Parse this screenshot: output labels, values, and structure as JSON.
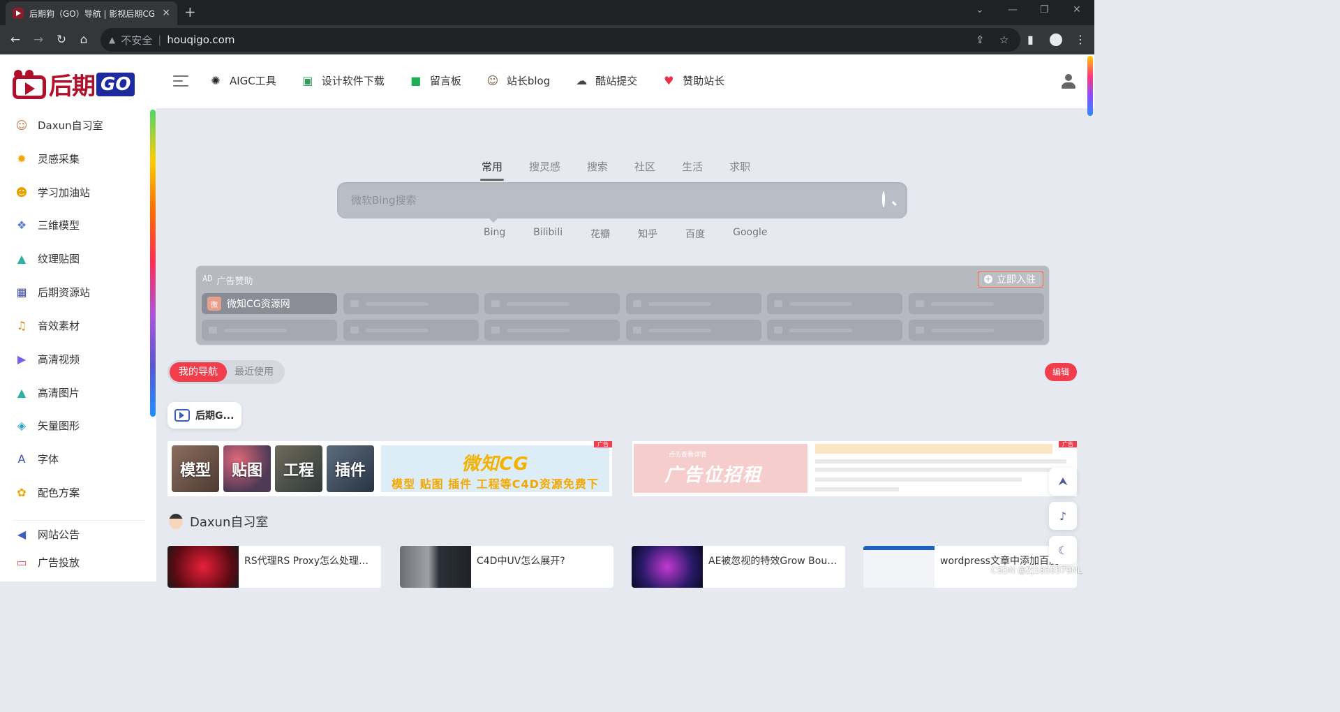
{
  "browser": {
    "tab_title": "后期狗（GO）导航 | 影视后期CG",
    "tab_close": "✕",
    "new_tab": "+",
    "back": "←",
    "forward": "→",
    "reload": "↻",
    "home": "⌂",
    "security_icon": "▲",
    "insecure_label": "不安全",
    "separator": "|",
    "url": "houqigo.com",
    "share": "⇪",
    "bookmark": "☆",
    "sidepanel": "▮",
    "menu": "⋮",
    "win_chevron": "⌄",
    "win_min": "—",
    "win_max": "❐",
    "win_close": "✕"
  },
  "header": {
    "logo_text": "后期",
    "logo_go": "GO",
    "nav": [
      {
        "label": "AIGC工具",
        "icon": "sparkle-dragon-icon",
        "glyph": "✺",
        "color": "#222"
      },
      {
        "label": "设计软件下载",
        "icon": "floppy-save-icon",
        "glyph": "▣",
        "color": "#2e9e5b"
      },
      {
        "label": "留言板",
        "icon": "message-board-icon",
        "glyph": "■",
        "color": "#1fae55"
      },
      {
        "label": "站长blog",
        "icon": "avatar-face-icon",
        "glyph": "☺",
        "color": "#7a5a3c"
      },
      {
        "label": "酷站提交",
        "icon": "cloud-upload-icon",
        "glyph": "☁",
        "color": "#444"
      },
      {
        "label": "赞助站长",
        "icon": "heart-icon",
        "glyph": "♥",
        "color": "#e8304b"
      }
    ]
  },
  "sidebar": {
    "items": [
      {
        "label": "Daxun自习室",
        "icon": "avatar-face-icon",
        "glyph": "☺",
        "color": "#c07a4a"
      },
      {
        "label": "灵感采集",
        "icon": "lightbulb-icon",
        "glyph": "✹",
        "color": "#f0a400"
      },
      {
        "label": "学习加油站",
        "icon": "head-idea-icon",
        "glyph": "☻",
        "color": "#e8a200"
      },
      {
        "label": "三维模型",
        "icon": "cubes-icon",
        "glyph": "❖",
        "color": "#5a7ad0"
      },
      {
        "label": "纹理贴图",
        "icon": "landscape-icon",
        "glyph": "▲",
        "color": "#2bb3a0"
      },
      {
        "label": "后期资源站",
        "icon": "clapperboard-icon",
        "glyph": "▦",
        "color": "#3d4fa8"
      },
      {
        "label": "音效素材",
        "icon": "music-note-icon",
        "glyph": "♫",
        "color": "#d08a1a"
      },
      {
        "label": "高清视频",
        "icon": "video-camera-icon",
        "glyph": "▶",
        "color": "#7b5cf0"
      },
      {
        "label": "高清图片",
        "icon": "image-icon",
        "glyph": "▲",
        "color": "#2bb3a0"
      },
      {
        "label": "矢量图形",
        "icon": "vector-gem-icon",
        "glyph": "◈",
        "color": "#2ba6c8"
      },
      {
        "label": "字体",
        "icon": "font-letter-icon",
        "glyph": "A",
        "color": "#3d4fa8"
      },
      {
        "label": "配色方案",
        "icon": "palette-icon",
        "glyph": "✿",
        "color": "#f0a400"
      },
      {
        "label": "网站公告",
        "icon": "megaphone-icon",
        "glyph": "◀",
        "color": "#3d5fc0"
      },
      {
        "label": "广告投放",
        "icon": "billboard-icon",
        "glyph": "▭",
        "color": "#e84a5f"
      }
    ]
  },
  "search": {
    "tabs": [
      "常用",
      "搜灵感",
      "搜索",
      "社区",
      "生活",
      "求职"
    ],
    "active_tab": 0,
    "placeholder": "微软Bing搜索",
    "engines": [
      "Bing",
      "Bilibili",
      "花瓣",
      "知乎",
      "百度",
      "Google"
    ],
    "active_engine": 0
  },
  "ad": {
    "tag": "AD",
    "title": "广告赞助",
    "join_label": "立即入驻",
    "join_icon": "+",
    "first_slot_label": "微知CG资源网",
    "first_slot_avatar": "微"
  },
  "mynav": {
    "active_label": "我的导航",
    "other_label": "最近使用",
    "edit_label": "编辑",
    "site_card_label": "后期G..."
  },
  "banner1": {
    "thumbs": [
      "模型",
      "贴图",
      "工程",
      "插件"
    ],
    "title": "微知CG",
    "subtitle": "模型 贴图 插件 工程等C4D资源免费下",
    "badge": "广告"
  },
  "banner2": {
    "small": "点击查看详情",
    "big": "广告位招租",
    "badge": "广告"
  },
  "section": {
    "title": "Daxun自习室"
  },
  "posts": [
    {
      "title": "RS代理RS Proxy怎么处理多..."
    },
    {
      "title": "C4D中UV怎么展开?"
    },
    {
      "title": "AE被忽视的特效Grow Boun..."
    },
    {
      "title": "wordpress文章中添加百度..."
    }
  ],
  "floating": {
    "top_icon": "⮝",
    "bell_icon": "♪",
    "moon_icon": "☾"
  },
  "watermark": "CSDN @Zj1850379NL"
}
